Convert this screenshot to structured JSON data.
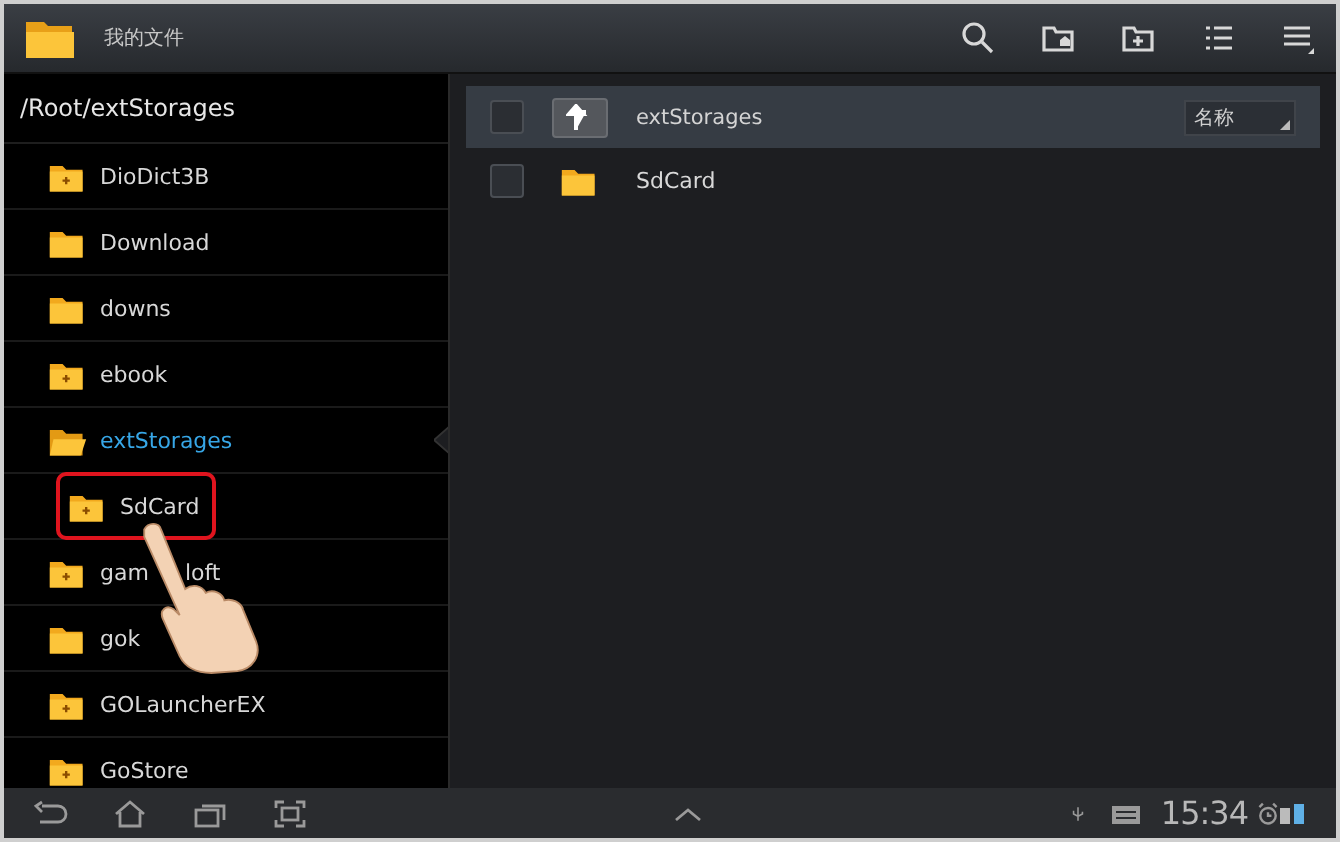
{
  "action_bar": {
    "title": "我的文件"
  },
  "path": "/Root/extStorages",
  "folders": [
    {
      "label_parts": [
        "DioDict3B"
      ],
      "kind": "plus",
      "selected": false,
      "highlighted": false
    },
    {
      "label_parts": [
        "Download"
      ],
      "kind": "plain",
      "selected": false,
      "highlighted": false
    },
    {
      "label_parts": [
        "downs"
      ],
      "kind": "plain",
      "selected": false,
      "highlighted": false
    },
    {
      "label_parts": [
        "ebook"
      ],
      "kind": "plus",
      "selected": false,
      "highlighted": false
    },
    {
      "label_parts": [
        "extStorages"
      ],
      "kind": "open",
      "selected": true,
      "highlighted": false,
      "children": [
        {
          "label_parts": [
            "SdCard"
          ],
          "kind": "plus",
          "selected": false,
          "highlighted": true
        }
      ]
    },
    {
      "label_parts": [
        "gam",
        "loft"
      ],
      "kind": "plus",
      "selected": false,
      "highlighted": false
    },
    {
      "label_parts": [
        "gok"
      ],
      "kind": "plain",
      "selected": false,
      "highlighted": false
    },
    {
      "label_parts": [
        "GOLauncherEX"
      ],
      "kind": "plus",
      "selected": false,
      "highlighted": false
    },
    {
      "label_parts": [
        "GoStore"
      ],
      "kind": "plus",
      "selected": false,
      "highlighted": false
    }
  ],
  "content": {
    "select_all_checked": false,
    "current_folder": "extStorages",
    "sort": "名称",
    "files": [
      {
        "name": "SdCard",
        "checked": false
      }
    ]
  },
  "status_bar": {
    "time": "15:34"
  }
}
